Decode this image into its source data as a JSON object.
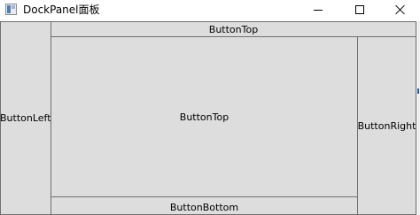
{
  "window": {
    "title": "DockPanel面板",
    "app_icon": "wpf-window-icon",
    "controls": {
      "minimize_icon": "minimize-icon",
      "maximize_icon": "maximize-icon",
      "close_icon": "close-icon"
    }
  },
  "dock_panel": {
    "background": "#dddddd",
    "button_border": "#707070",
    "left_label": "ButtonLeft",
    "top_label": "ButtonTop",
    "bottom_label": "ButtonBottom",
    "right_label": "ButtonRight",
    "fill_label": "ButtonTop"
  }
}
